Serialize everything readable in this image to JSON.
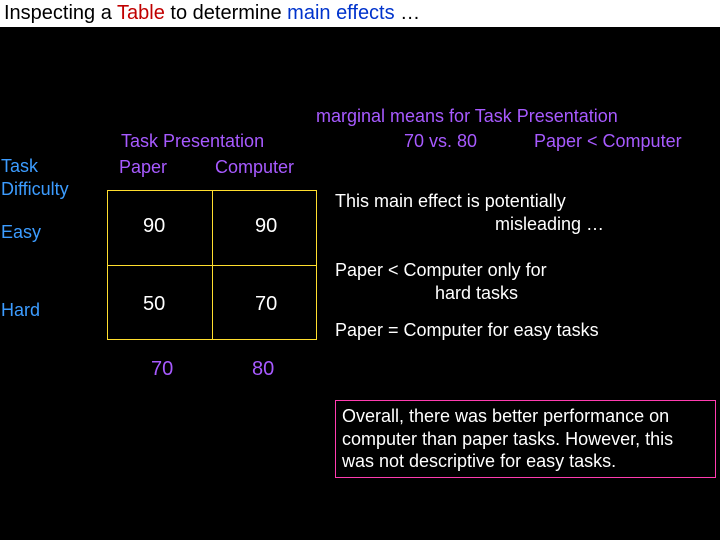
{
  "title": {
    "p1": "Inspecting a ",
    "p2": "Table",
    "p3": " to determine ",
    "p4": "main effects",
    "p5": " …"
  },
  "labels": {
    "task_presentation": "Task Presentation",
    "paper": "Paper",
    "computer": "Computer",
    "task_difficulty_l1": "Task",
    "task_difficulty_l2": "Difficulty",
    "easy": "Easy",
    "hard": "Hard"
  },
  "cells": {
    "easy_paper": "90",
    "easy_computer": "90",
    "hard_paper": "50",
    "hard_computer": "70",
    "col_mean_paper": "70",
    "col_mean_computer": "80"
  },
  "marginal": {
    "title": "marginal means for Task Presentation",
    "vs": "70 vs. 80",
    "cmp": "Paper < Computer"
  },
  "notes": {
    "n1a": "This main effect is potentially",
    "n1b": "misleading …",
    "n2a": "Paper < Computer only for",
    "n2b": "hard tasks",
    "n3": "Paper = Computer for easy tasks"
  },
  "summary": "Overall, there was better performance on computer than paper tasks.  However, this was not descriptive for easy tasks.",
  "chart_data": {
    "type": "table",
    "row_factor": "Task Difficulty",
    "col_factor": "Task Presentation",
    "rows": [
      "Easy",
      "Hard"
    ],
    "cols": [
      "Paper",
      "Computer"
    ],
    "values": [
      [
        90,
        90
      ],
      [
        50,
        70
      ]
    ],
    "col_marginal_means": [
      70,
      80
    ],
    "marginal_comparison": "Paper < Computer",
    "annotations": [
      "This main effect is potentially misleading …",
      "Paper < Computer only for hard tasks",
      "Paper = Computer for easy tasks"
    ]
  }
}
